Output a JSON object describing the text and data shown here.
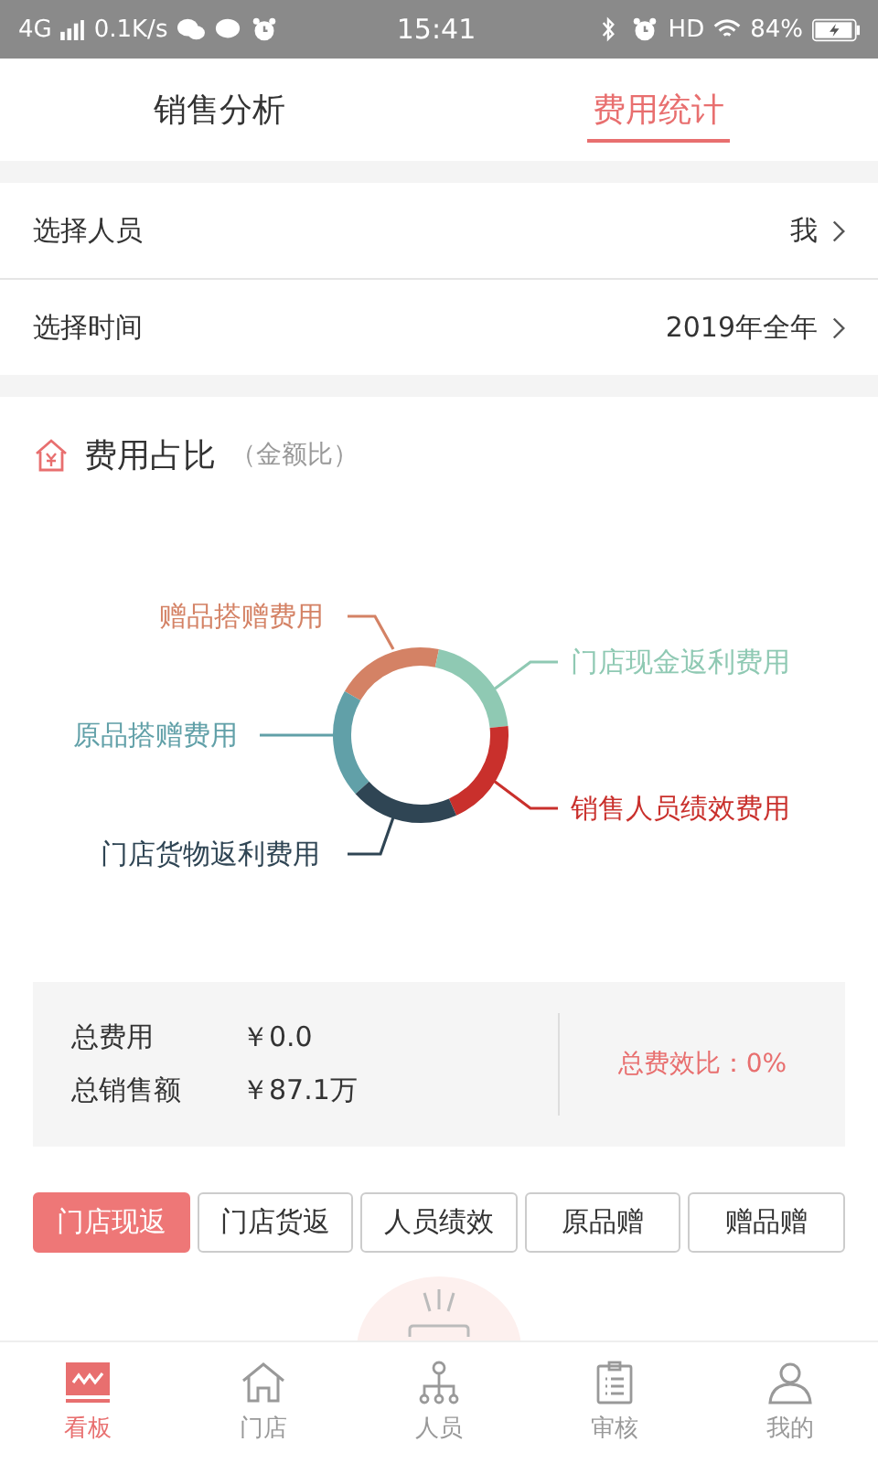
{
  "status_bar": {
    "network": "4G",
    "speed": "0.1K/s",
    "time": "15:41",
    "hd": "HD",
    "battery": "84%"
  },
  "tabs": [
    {
      "label": "销售分析",
      "selected": false
    },
    {
      "label": "费用统计",
      "selected": true
    }
  ],
  "filters": [
    {
      "label": "选择人员",
      "value": "我"
    },
    {
      "label": "选择时间",
      "value": "2019年全年"
    }
  ],
  "section": {
    "title": "费用占比",
    "subtitle": "（金额比）"
  },
  "donut": {
    "segments": [
      {
        "label": "赠品搭赠费用",
        "color": "#d48265"
      },
      {
        "label": "门店现金返利费用",
        "color": "#8fc9b3"
      },
      {
        "label": "原品搭赠费用",
        "color": "#61a0a8"
      },
      {
        "label": "销售人员绩效费用",
        "color": "#c9302c"
      },
      {
        "label": "门店货物返利费用",
        "color": "#2f4554"
      }
    ]
  },
  "summary": {
    "rows": [
      {
        "label": "总费用",
        "value": "￥0.0"
      },
      {
        "label": "总销售额",
        "value": "￥87.1万"
      }
    ],
    "ratio": "总费效比：0%"
  },
  "categories": [
    {
      "label": "门店现返",
      "selected": true
    },
    {
      "label": "门店货返",
      "selected": false
    },
    {
      "label": "人员绩效",
      "selected": false
    },
    {
      "label": "原品赠",
      "selected": false
    },
    {
      "label": "赠品赠",
      "selected": false
    }
  ],
  "nav": [
    {
      "label": "看板",
      "kind": "board",
      "selected": true
    },
    {
      "label": "门店",
      "kind": "store",
      "selected": false
    },
    {
      "label": "人员",
      "kind": "people",
      "selected": false
    },
    {
      "label": "审核",
      "kind": "review",
      "selected": false
    },
    {
      "label": "我的",
      "kind": "me",
      "selected": false
    }
  ]
}
